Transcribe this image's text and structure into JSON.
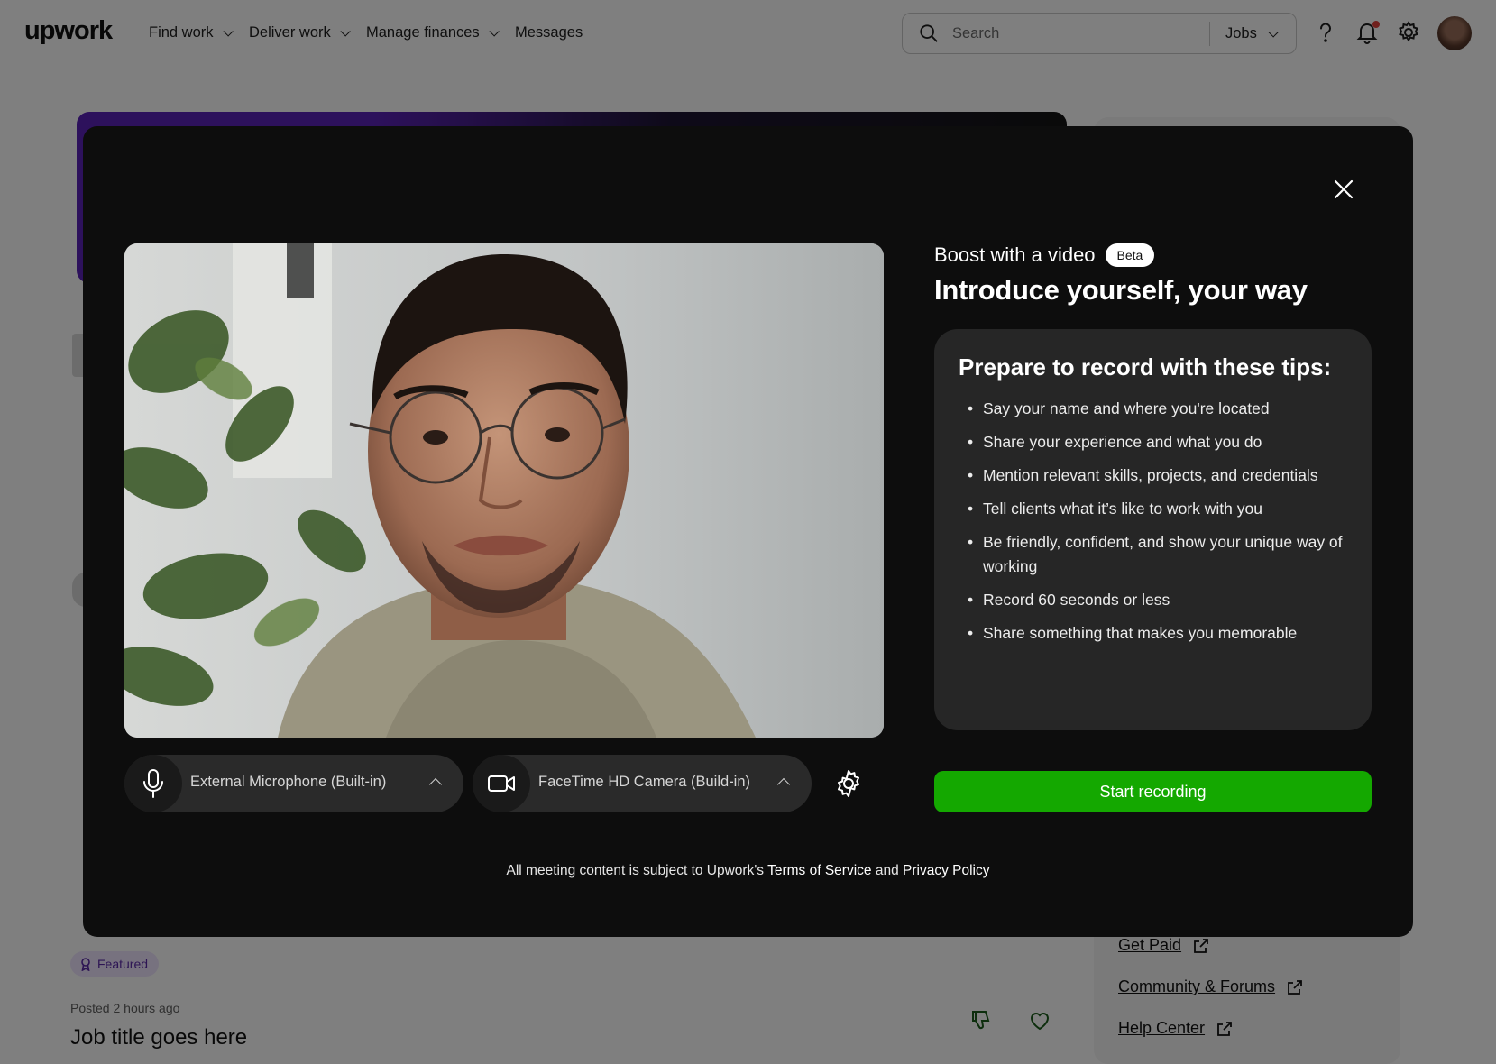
{
  "nav": {
    "logo": "upwork",
    "links": [
      {
        "label": "Find work",
        "dropdown": true
      },
      {
        "label": "Deliver work",
        "dropdown": true
      },
      {
        "label": "Manage finances",
        "dropdown": true
      },
      {
        "label": "Messages",
        "dropdown": false
      }
    ],
    "search": {
      "placeholder": "Search",
      "scope": "Jobs"
    },
    "icons": [
      "help-icon",
      "notification-bell-icon",
      "settings-icon",
      "avatar"
    ],
    "notification_dot_color": "#e0403a"
  },
  "background": {
    "side_links": [
      {
        "label": "Get Paid",
        "icon": "external-link-icon"
      },
      {
        "label": "Community & Forums",
        "icon": "external-link-icon"
      },
      {
        "label": "Help Center",
        "icon": "external-link-icon"
      }
    ],
    "featured_label": "Featured",
    "posted": "Posted 2 hours ago",
    "job_title": "Job title goes here",
    "job_icons": [
      "thumbs-down-icon",
      "heart-icon"
    ]
  },
  "modal": {
    "close_icon": "close-icon",
    "devices": {
      "microphone": {
        "label": "External Microphone (Built-in)",
        "icon": "microphone-icon"
      },
      "camera": {
        "label": "FaceTime HD Camera (Build-in)",
        "icon": "video-camera-icon"
      },
      "settings_icon": "gear-icon"
    },
    "eyebrow": "Boost with a video",
    "badge": "Beta",
    "headline": "Introduce yourself, your way",
    "tips": {
      "title": "Prepare to record with these tips:",
      "items": [
        "Say your name and where you're located",
        "Share your experience and what you do",
        "Mention relevant skills, projects, and credentials",
        "Tell clients what it’s like to work with you",
        "Be friendly, confident, and show your unique way of working",
        "Record 60 seconds or less",
        "Share something that makes you memorable"
      ]
    },
    "start_button": "Start recording",
    "legal": {
      "prefix": "All meeting content is subject to Upwork's",
      "terms": "Terms of Service",
      "and": "and",
      "privacy": "Privacy Policy"
    },
    "colors": {
      "primary_button": "#14a800",
      "modal_bg": "#0d0d0d",
      "tips_panel_bg": "#262626"
    }
  }
}
